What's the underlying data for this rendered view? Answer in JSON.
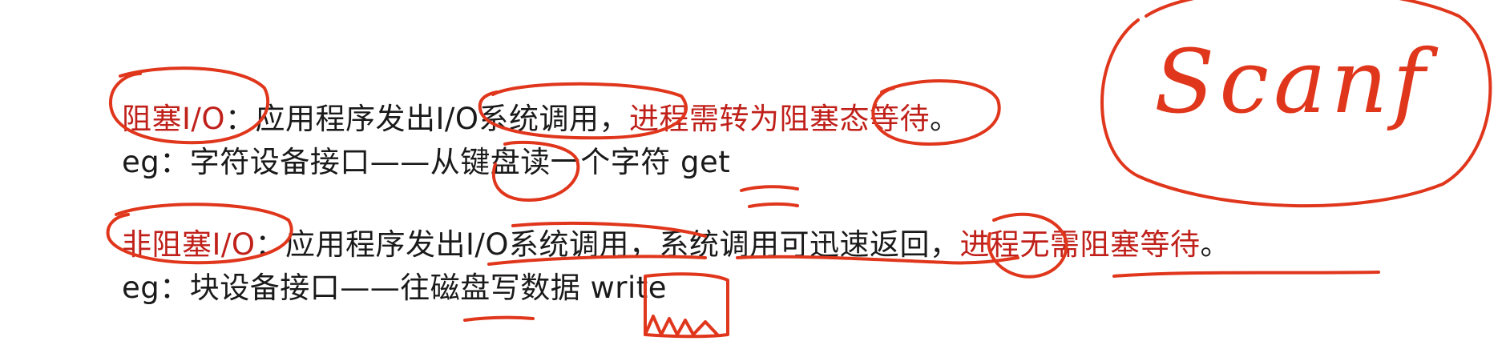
{
  "colors": {
    "text": "#1a1a1a",
    "red": "#c0201a",
    "ink": "#e0361c"
  },
  "slide": {
    "blocking": {
      "term": "阻塞I/O",
      "colon": "：",
      "text1": "应用程序发出I/O系统调用，",
      "text_red": "进程需转为阻塞态等待",
      "end": "。",
      "example_prefix": "eg：",
      "example_text": "字符设备接口——从键盘读一个字符 ",
      "example_word": "get"
    },
    "nonblocking": {
      "term": "非阻塞I/O",
      "colon": "：",
      "text1": "应用程序发出I/O系统调用，系统调用可迅速返回，",
      "text_red": "进程无需阻塞等待",
      "end": "。",
      "example_prefix": "eg：",
      "example_text": "块设备接口——往磁盘写数据 ",
      "example_word": "write"
    }
  },
  "handwriting": {
    "word": "Scanf"
  }
}
